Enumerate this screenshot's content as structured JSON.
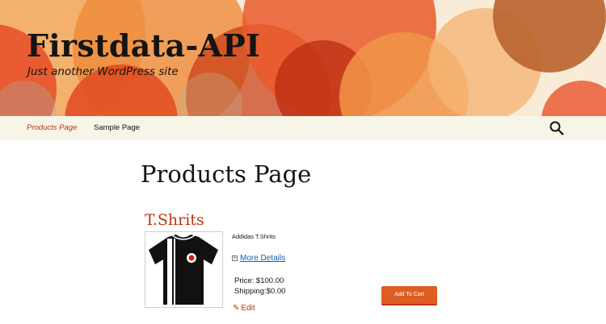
{
  "site": {
    "title": "Firstdata-API",
    "description": "Just another WordPress site"
  },
  "nav": {
    "items": [
      {
        "label": "Products Page",
        "active": true
      },
      {
        "label": "Sample Page",
        "active": false
      }
    ],
    "search_icon": "search-icon"
  },
  "page": {
    "title": "Products Page"
  },
  "product": {
    "title": "T.Shrits",
    "name": "Addidas T.Shrits",
    "more_details": "More Details",
    "price": "Price: $100.00",
    "shipping": "Shipping:$0.00",
    "edit": "Edit",
    "add_to_cart": "Add To Cart"
  },
  "colors": {
    "accent": "#bc360a",
    "button": "#e05d22",
    "nav_bg": "#f7f5e7",
    "link": "#0c5fb8"
  }
}
